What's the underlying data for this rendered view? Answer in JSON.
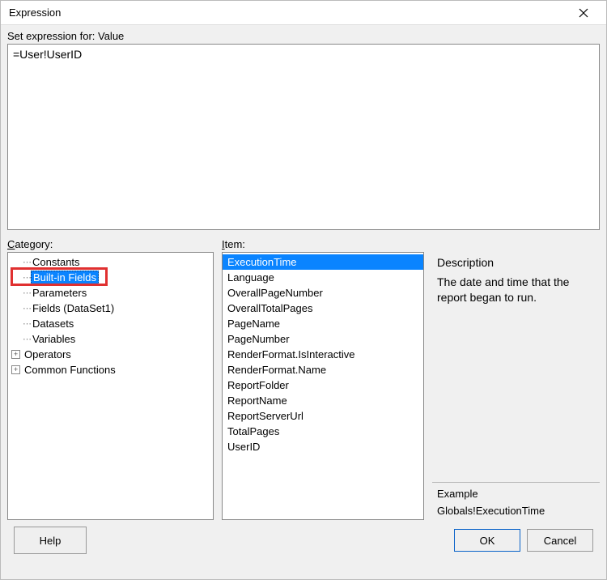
{
  "window": {
    "title": "Expression"
  },
  "set_for_label": "Set expression for: Value",
  "expression_text": "=User!UserID",
  "labels": {
    "category": "Category:",
    "item": "Item:",
    "description": "Description",
    "example": "Example"
  },
  "categories": [
    {
      "label": "Constants",
      "expand": "none",
      "indent": 1,
      "selected": false
    },
    {
      "label": "Built-in Fields",
      "expand": "none",
      "indent": 1,
      "selected": true
    },
    {
      "label": "Parameters",
      "expand": "none",
      "indent": 1,
      "selected": false
    },
    {
      "label": "Fields (DataSet1)",
      "expand": "none",
      "indent": 1,
      "selected": false
    },
    {
      "label": "Datasets",
      "expand": "none",
      "indent": 1,
      "selected": false
    },
    {
      "label": "Variables",
      "expand": "none",
      "indent": 1,
      "selected": false
    },
    {
      "label": "Operators",
      "expand": "plus",
      "indent": 0,
      "selected": false
    },
    {
      "label": "Common Functions",
      "expand": "plus",
      "indent": 0,
      "selected": false
    }
  ],
  "items": [
    {
      "label": "ExecutionTime",
      "selected": true
    },
    {
      "label": "Language",
      "selected": false
    },
    {
      "label": "OverallPageNumber",
      "selected": false
    },
    {
      "label": "OverallTotalPages",
      "selected": false
    },
    {
      "label": "PageName",
      "selected": false
    },
    {
      "label": "PageNumber",
      "selected": false
    },
    {
      "label": "RenderFormat.IsInteractive",
      "selected": false
    },
    {
      "label": "RenderFormat.Name",
      "selected": false
    },
    {
      "label": "ReportFolder",
      "selected": false
    },
    {
      "label": "ReportName",
      "selected": false
    },
    {
      "label": "ReportServerUrl",
      "selected": false
    },
    {
      "label": "TotalPages",
      "selected": false
    },
    {
      "label": "UserID",
      "selected": false
    }
  ],
  "description_text": "The date and time that the report began to run.",
  "example_text": "Globals!ExecutionTime",
  "buttons": {
    "help": "Help",
    "ok": "OK",
    "cancel": "Cancel"
  }
}
